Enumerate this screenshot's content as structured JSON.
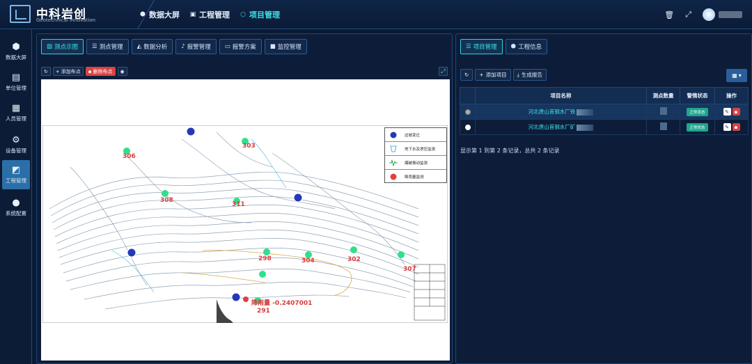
{
  "brand": {
    "name_cn": "中科岩创",
    "name_en": "Geotechnical Innovation"
  },
  "topnav": [
    {
      "label": "数据大屏",
      "icon": "cube-icon"
    },
    {
      "label": "工程管理",
      "icon": "monitor-icon"
    },
    {
      "label": "项目管理",
      "icon": "circle-icon",
      "active": true
    }
  ],
  "sidebar": [
    {
      "label": "数据大屏",
      "icon": "cube-icon"
    },
    {
      "label": "单位管理",
      "icon": "calendar-icon"
    },
    {
      "label": "人员管理",
      "icon": "person-card-icon"
    },
    {
      "label": "设备管理",
      "icon": "gear-icon"
    },
    {
      "label": "工程管理",
      "icon": "chart-icon",
      "active": true
    },
    {
      "label": "系统配置",
      "icon": "dots-icon"
    }
  ],
  "left_tabs": [
    {
      "label": "测点示图",
      "active": true
    },
    {
      "label": "测点管理"
    },
    {
      "label": "数据分析"
    },
    {
      "label": "报警管理"
    },
    {
      "label": "报警方案"
    },
    {
      "label": "监控管理"
    }
  ],
  "map_tools": {
    "add_label": "添加布点",
    "delete_label": "删除布点"
  },
  "legend": [
    {
      "label": "边坡变迁",
      "icon": "blue-circle-icon"
    },
    {
      "label": "地下水及渗压监测",
      "icon": "water-cup-icon"
    },
    {
      "label": "爆破振动监测",
      "icon": "vibration-icon"
    },
    {
      "label": "降雨量监测",
      "icon": "rain-gauge-icon"
    }
  ],
  "map_labels": {
    "p303": "303",
    "p306": "306",
    "p308": "308",
    "p311": "311",
    "p298": "298",
    "p304": "304",
    "p302": "302",
    "p307": "307",
    "p291": "291",
    "rain_text": "降雨量",
    "rain_value": "-0.2407001"
  },
  "right_tabs": [
    {
      "label": "项目管理",
      "active": true
    },
    {
      "label": "工程信息"
    }
  ],
  "project_tools": {
    "add_label": "添加项目",
    "report_label": "生成报告"
  },
  "project_table": {
    "headers": [
      "项目名称",
      "测点数量",
      "警情状态",
      "操作"
    ],
    "rows": [
      {
        "name": "河北唐山首钢水厂铁",
        "status": "正常状态",
        "selected": true
      },
      {
        "name": "河北唐山首钢水厂矿",
        "status": "正常状态",
        "selected": false
      }
    ]
  },
  "pagination": "显示第 1 到第 2 条记录，总共 2 条记录",
  "colors": {
    "accent": "#3fe0ea",
    "danger": "#d84343",
    "badge": "#1fa58f",
    "background": "#0b1a33"
  }
}
